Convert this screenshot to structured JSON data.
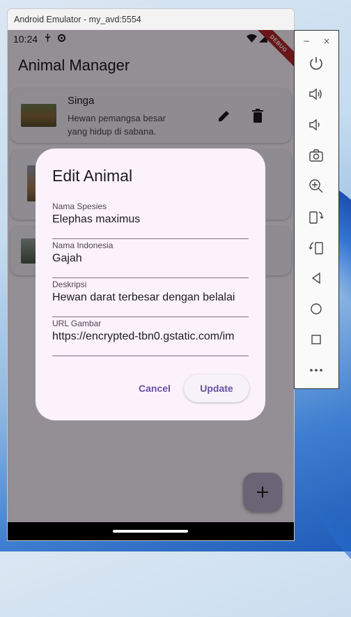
{
  "emulator": {
    "title": "Android Emulator - my_avd:5554"
  },
  "statusbar": {
    "time": "10:24",
    "debug_label": "DEBUG"
  },
  "app": {
    "title": "Animal Manager"
  },
  "list": {
    "items": [
      {
        "name": "Singa",
        "description": "Hewan pemangsa besar yang hidup di sabana."
      }
    ]
  },
  "dialog": {
    "title": "Edit Animal",
    "fields": [
      {
        "label": "Nama Spesies",
        "value": "Elephas maximus"
      },
      {
        "label": "Nama Indonesia",
        "value": "Gajah"
      },
      {
        "label": "Deskripsi",
        "value": "Hewan darat terbesar dengan belalai"
      },
      {
        "label": "URL Gambar",
        "value": "https://encrypted-tbn0.gstatic.com/im"
      }
    ],
    "cancel_label": "Cancel",
    "update_label": "Update"
  },
  "toolbar": {
    "minimize": "−",
    "close": "×",
    "buttons": [
      "power-icon",
      "volume-up-icon",
      "volume-down-icon",
      "camera-icon",
      "zoom-icon",
      "rotate-left-icon",
      "rotate-right-icon",
      "back-icon",
      "home-icon",
      "overview-icon",
      "more-icon"
    ]
  },
  "colors": {
    "accent": "#6750a4",
    "dialog_bg": "#fcf2fc",
    "debug_banner": "#b3262a"
  }
}
